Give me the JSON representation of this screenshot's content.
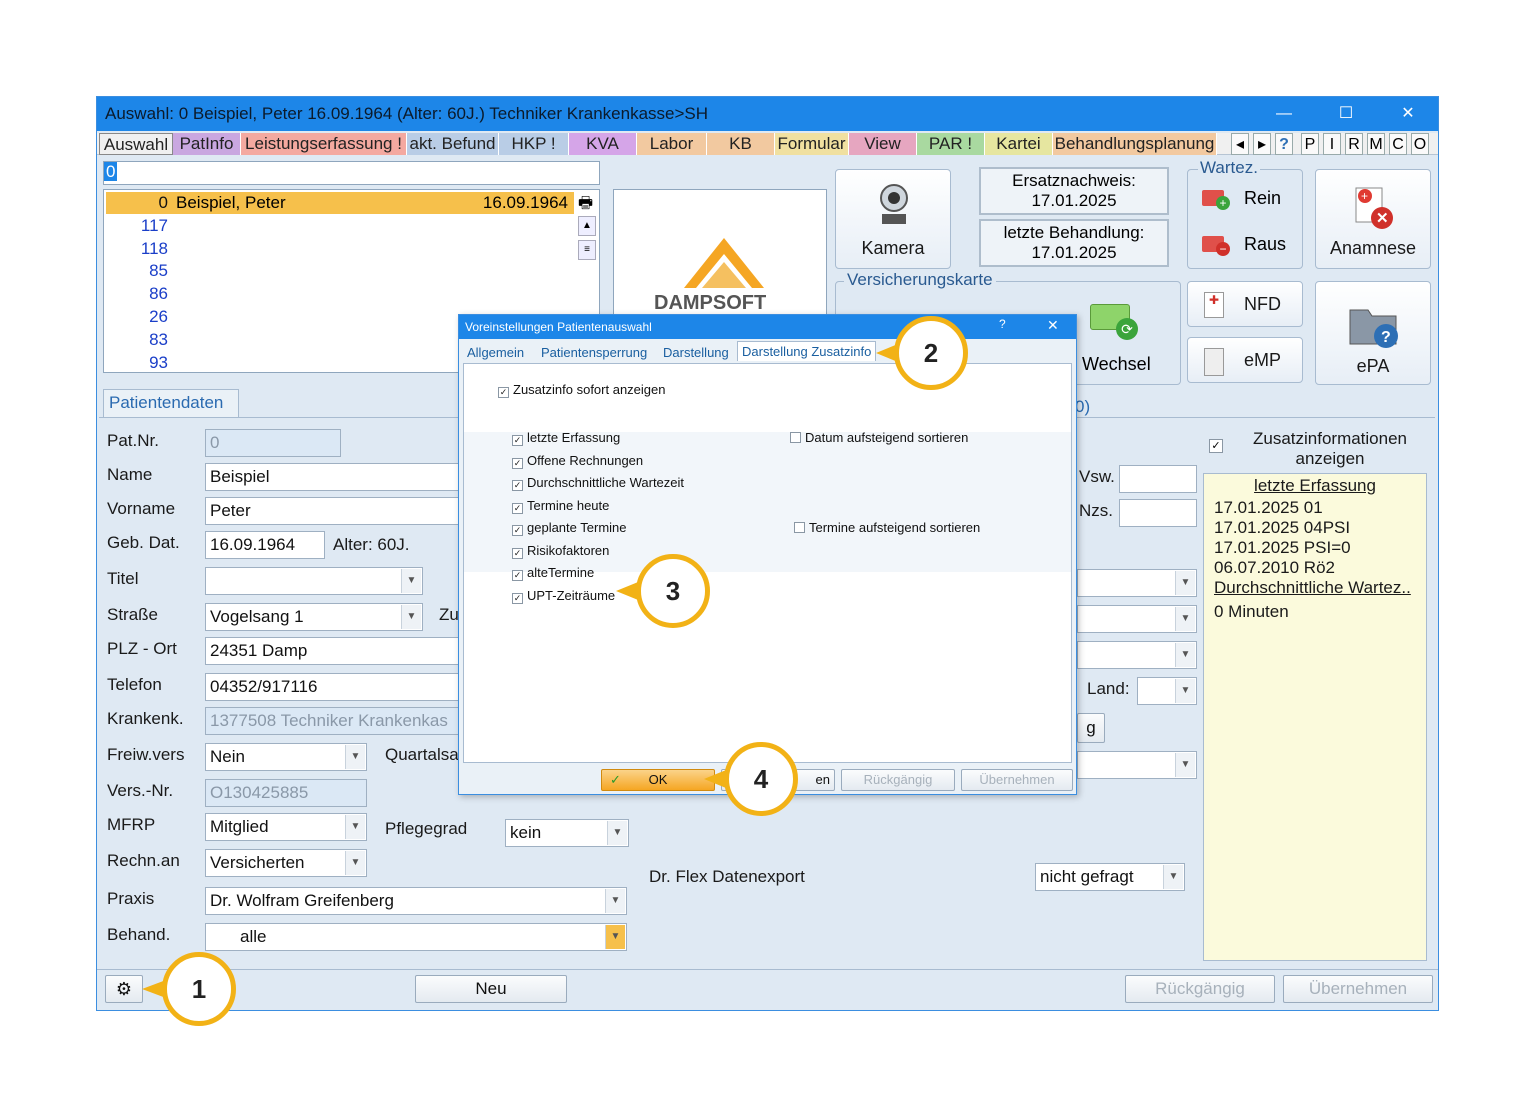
{
  "window": {
    "title": "Auswahl: 0  Beispiel, Peter  16.09.1964 (Alter: 60J.)  Techniker Krankenkasse>SH",
    "minimize": "—",
    "maximize": "☐",
    "close": "✕"
  },
  "tabs": [
    "Auswahl",
    "PatInfo",
    "Leistungserfassung !",
    "akt. Befund",
    "HKP !",
    "KVA",
    "Labor",
    "KB",
    "Formular",
    "View",
    "PAR !",
    "Kartei",
    "Behandlungsplanung"
  ],
  "tab_colors": [
    "#f0f0f0",
    "#c9a7e0",
    "#f4a9a0",
    "#b9cde6",
    "#b9cde6",
    "#d5a5e8",
    "#f2c9a0",
    "#f2c9a0",
    "#f0e0a0",
    "#e6a6c0",
    "#a9d9a0",
    "#e6e6a0",
    "#f2c9a0"
  ],
  "tab_nav": {
    "prev": "◂",
    "next": "▸",
    "help": "?",
    "letters": [
      "P",
      "I",
      "R",
      "M",
      "C",
      "O"
    ]
  },
  "search": {
    "value": "0"
  },
  "patient_list": [
    {
      "nr": "0",
      "name": "Beispiel, Peter",
      "date": "16.09.1964"
    },
    {
      "nr": "117"
    },
    {
      "nr": "118"
    },
    {
      "nr": "85"
    },
    {
      "nr": "86"
    },
    {
      "nr": "26"
    },
    {
      "nr": "83"
    },
    {
      "nr": "93"
    }
  ],
  "logo_text": "DAMPSOFT",
  "buttons": {
    "kamera": "Kamera",
    "ersatznachweis_label": "Ersatznachweis:",
    "ersatznachweis_date": "17.01.2025",
    "letzte_behandlung_label": "letzte Behandlung:",
    "letzte_behandlung_date": "17.01.2025",
    "wartez_group": "Wartez.",
    "rein": "Rein",
    "raus": "Raus",
    "anamnese": "Anamnese",
    "versicherungskarte_group": "Versicherungskarte",
    "wechsel": "Wechsel",
    "nfd": "NFD",
    "emp": "eMP",
    "epa": "ePA"
  },
  "patientendaten": {
    "tab_label": "Patientendaten",
    "fields": {
      "patnr": {
        "label": "Pat.Nr.",
        "value": "0"
      },
      "name": {
        "label": "Name",
        "value": "Beispiel"
      },
      "vorname": {
        "label": "Vorname",
        "value": "Peter"
      },
      "gebdat": {
        "label": "Geb. Dat.",
        "value": "16.09.1964",
        "alter": "Alter: 60J."
      },
      "titel": {
        "label": "Titel",
        "value": ""
      },
      "strasse": {
        "label": "Straße",
        "value": "Vogelsang 1",
        "zu": "Zu"
      },
      "plzort": {
        "label": "PLZ - Ort",
        "value": "24351 Damp"
      },
      "telefon": {
        "label": "Telefon",
        "value": "04352/917116"
      },
      "krankenk": {
        "label": "Krankenk.",
        "value": "1377508 Techniker Krankenkas"
      },
      "freiw": {
        "label": "Freiw.vers",
        "value": "Nein",
        "quartal": "Quartalsa"
      },
      "versnr": {
        "label": "Vers.-Nr.",
        "value": "O130425885"
      },
      "mfrp": {
        "label": "MFRP",
        "value": "Mitglied",
        "pflegegrad_label": "Pflegegrad",
        "pflegegrad": "kein"
      },
      "rechnan": {
        "label": "Rechn.an",
        "value": "Versicherten"
      },
      "praxis": {
        "label": "Praxis",
        "value": "Dr. Wolfram Greifenberg"
      },
      "behand": {
        "label": "Behand.",
        "value": "alle"
      }
    }
  },
  "right_fields": {
    "vsw": "Vsw.",
    "nzs": "Nzs.",
    "land": "Land:",
    "count_fragment": "0)",
    "btn_fragment": "g",
    "drflex_label": "Dr. Flex Datenexport",
    "drflex_value": "nicht gefragt"
  },
  "zusatzinfo": {
    "checkbox_label": "Zusatzinformationen anzeigen",
    "heading": "letzte Erfassung",
    "lines": [
      "17.01.2025 01",
      "17.01.2025 04PSI",
      "17.01.2025 PSI=0",
      "06.07.2010 Rö2"
    ],
    "link2": "Durchschnittliche Wartez..",
    "wait": "0 Minuten"
  },
  "bottom": {
    "neu": "Neu",
    "rueckgaengig": "Rückgängig",
    "uebernehmen": "Übernehmen"
  },
  "dialog": {
    "title": "Voreinstellungen Patientenauswahl",
    "help": "?",
    "close": "✕",
    "tabs": [
      "Allgemein",
      "Patientensperrung",
      "Darstellung",
      "Darstellung Zusatzinfo"
    ],
    "sofort": "Zusatzinfo sofort anzeigen",
    "items": [
      "letzte Erfassung",
      "Offene Rechnungen",
      "Durchschnittliche Wartezeit",
      "Termine heute",
      "geplante Termine",
      "Risikofaktoren",
      "alteTermine",
      "UPT-Zeiträume"
    ],
    "datum_sort": "Datum aufsteigend sortieren",
    "termine_sort": "Termine aufsteigend sortieren",
    "ok": "OK",
    "abbrechen_fragment": "en",
    "rueckgaengig": "Rückgängig",
    "uebernehmen": "Übernehmen"
  },
  "callouts": [
    "1",
    "2",
    "3",
    "4"
  ],
  "colors": {
    "accent": "#1d86e8",
    "callout": "#f2b216",
    "selection": "#f6c04b",
    "ok": "#f5a623"
  }
}
